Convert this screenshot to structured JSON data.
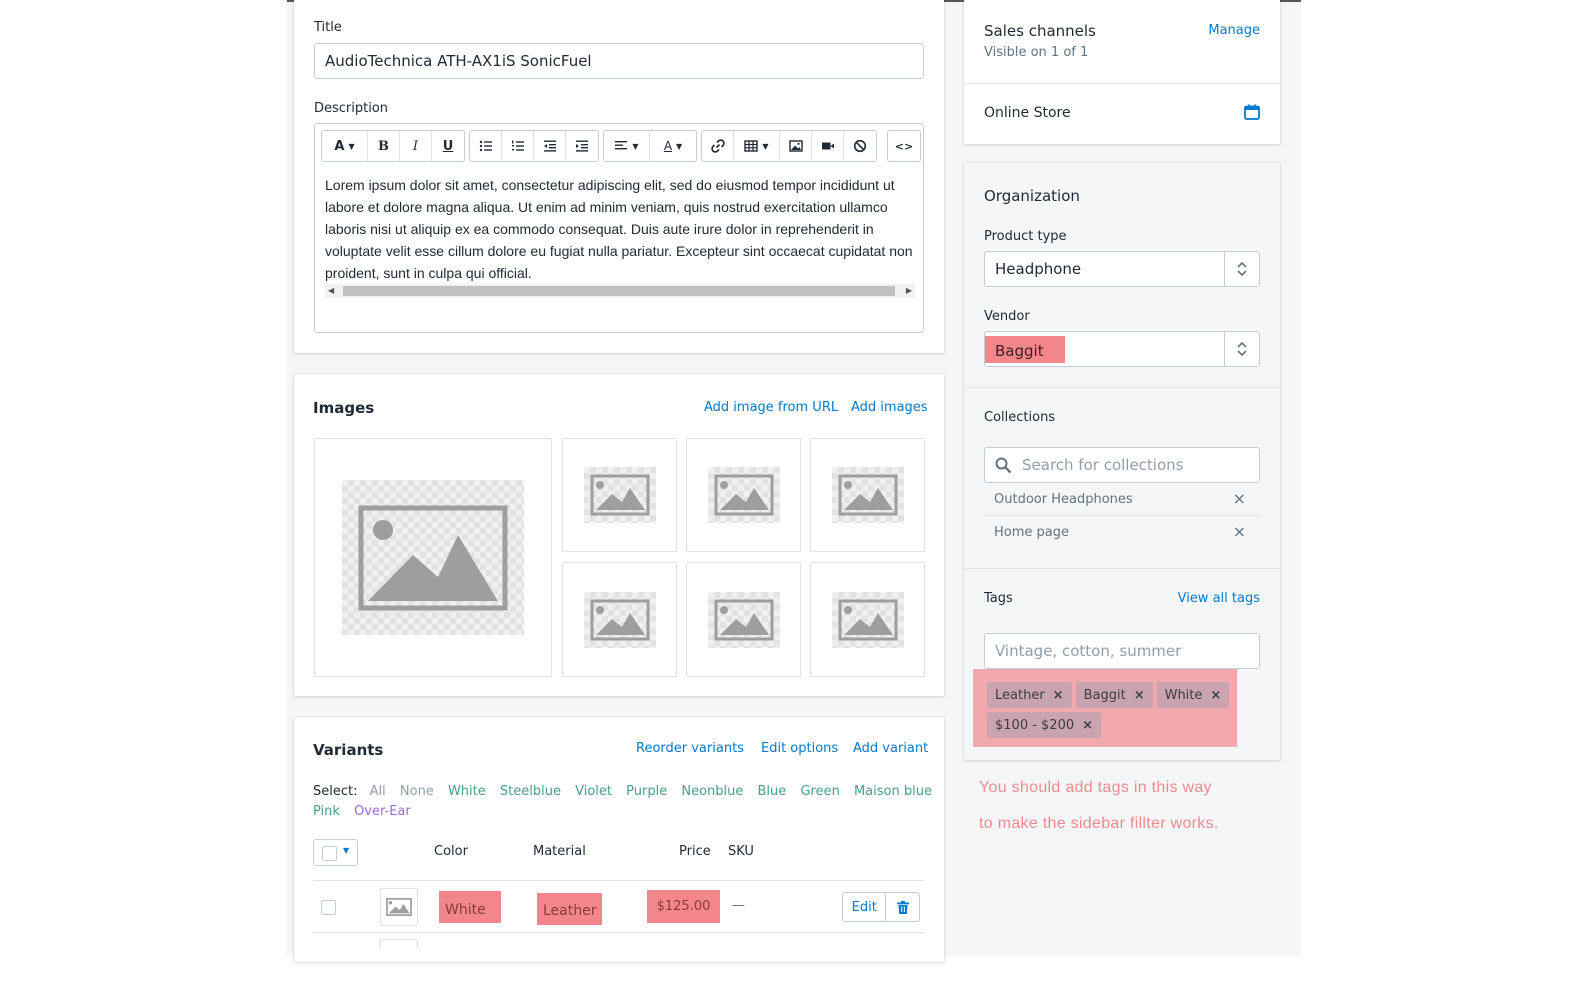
{
  "title_field": {
    "label": "Title",
    "value": "AudioTechnica ATH-AX1iS SonicFuel"
  },
  "description_field": {
    "label": "Description",
    "body": "Lorem ipsum dolor sit amet, consectetur adipiscing elit, sed do eiusmod tempor incididunt ut labore et dolore magna aliqua. Ut enim ad minim veniam, quis nostrud exercitation ullamco laboris nisi ut aliquip ex ea commodo consequat. Duis aute irure dolor in reprehenderit in voluptate velit esse cillum dolore eu fugiat nulla pariatur. Excepteur sint occaecat cupidatat non proident, sunt in culpa qui official.",
    "toolbar": {
      "font": "A",
      "bold": "B",
      "italic": "I",
      "underline": "U",
      "code": "<>"
    }
  },
  "images": {
    "heading": "Images",
    "add_from_url": "Add image from URL",
    "add_images": "Add images"
  },
  "variants": {
    "heading": "Variants",
    "reorder": "Reorder variants",
    "edit_options": "Edit options",
    "add_variant": "Add variant",
    "select_label": "Select:",
    "select_options": [
      "All",
      "None",
      "White",
      "Steelblue",
      "Violet",
      "Purple",
      "Neonblue",
      "Blue",
      "Green",
      "Maison blue",
      "Pink",
      "Over-Ear"
    ],
    "columns": {
      "color": "Color",
      "material": "Material",
      "price": "Price",
      "sku": "SKU"
    },
    "row": {
      "color": "White",
      "material": "Leather",
      "price": "$125.00",
      "sku": "—",
      "edit": "Edit"
    }
  },
  "sales_channels": {
    "heading": "Sales channels",
    "manage": "Manage",
    "visible": "Visible on 1 of 1",
    "online_store": "Online Store"
  },
  "organization": {
    "heading": "Organization",
    "product_type_label": "Product type",
    "product_type_value": "Headphone",
    "vendor_label": "Vendor",
    "vendor_value": "Baggit",
    "collections_label": "Collections",
    "collections_placeholder": "Search for collections",
    "collections": [
      "Outdoor Headphones",
      "Home page"
    ]
  },
  "tags": {
    "heading": "Tags",
    "view_all": "View all tags",
    "placeholder": "Vintage, cotton, summer",
    "chips": [
      "Leather",
      "Baggit",
      "White",
      "$100 - $200"
    ],
    "close_glyph": "×"
  },
  "annotation": {
    "line1": "You should add tags in this way",
    "line2": "to make the sidebar fillter works."
  },
  "colors": {
    "link": "#007ace",
    "highlight": "#f2868a",
    "tag_area": "#f1a9ad",
    "annotation": "#f08a8f",
    "green_option": "#47a08a",
    "purple_option": "#9c6ade"
  }
}
